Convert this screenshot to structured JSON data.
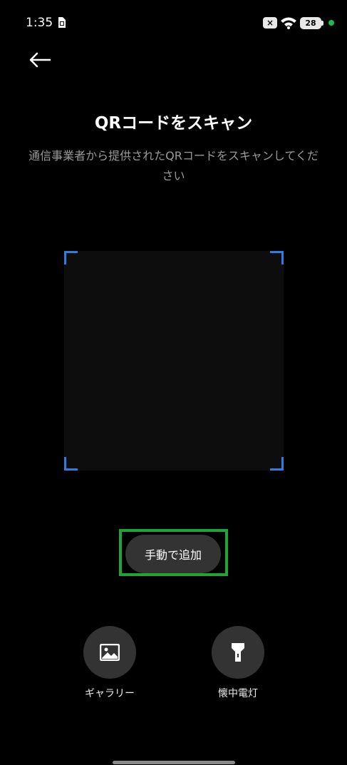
{
  "status_bar": {
    "time": "1:35",
    "battery_level": "28",
    "nosim_glyph": "×"
  },
  "header": {
    "back_icon": "arrow-left-icon"
  },
  "content": {
    "title": "QRコードをスキャン",
    "subtitle": "通信事業者から提供されたQRコードをスキャンしてください"
  },
  "scanner": {
    "corner_color": "#2f7de1"
  },
  "manual_add": {
    "label": "手動で追加",
    "highlight_color": "#1fa537"
  },
  "actions": {
    "gallery": {
      "label": "ギャラリー",
      "icon": "image-icon"
    },
    "flashlight": {
      "label": "懐中電灯",
      "icon": "flashlight-icon"
    }
  },
  "colors": {
    "background": "#000000",
    "button_bg": "#333333"
  }
}
